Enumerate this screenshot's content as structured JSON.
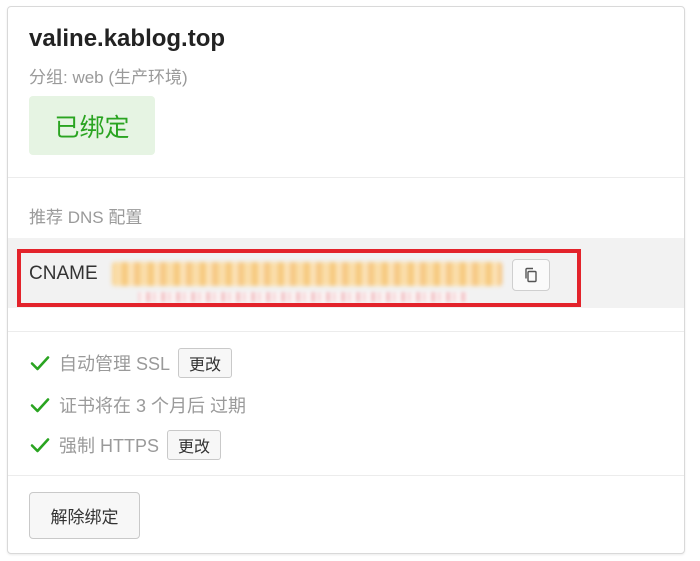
{
  "domain": {
    "name": "valine.kablog.top",
    "group": "分组: web (生产环境)",
    "status_label": "已绑定"
  },
  "dns": {
    "section_label": "推荐 DNS 配置",
    "record_type": "CNAME",
    "record_value": "redacted",
    "copy_icon": "copy-icon"
  },
  "ssl": {
    "auto_label": "自动管理 SSL",
    "auto_change_label": "更改",
    "expiry_label": "证书将在 3 个月后 过期",
    "https_label": "强制 HTTPS",
    "https_change_label": "更改",
    "check_icon": "check-icon"
  },
  "actions": {
    "unbind_label": "解除绑定"
  },
  "colors": {
    "success": "#2aa421",
    "success_bg": "#e6f4e3",
    "highlight": "#e3232b",
    "muted": "#9a9a9a"
  }
}
